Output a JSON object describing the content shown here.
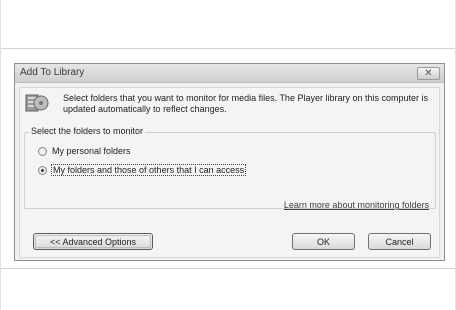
{
  "dialog": {
    "title": "Add To Library",
    "close_glyph": "✕",
    "icon": "media-library-icon",
    "description": "Select folders that you want to monitor for media files. The Player library on this computer is updated automatically to reflect changes.",
    "group_label": "Select the folders to monitor",
    "options": [
      {
        "label": "My personal folders",
        "checked": false
      },
      {
        "label": "My folders and those of others that I can access",
        "checked": true
      }
    ],
    "learn_more_link": "Learn more about monitoring folders",
    "advanced_button": "<< Advanced Options",
    "ok_button": "OK",
    "cancel_button": "Cancel"
  }
}
